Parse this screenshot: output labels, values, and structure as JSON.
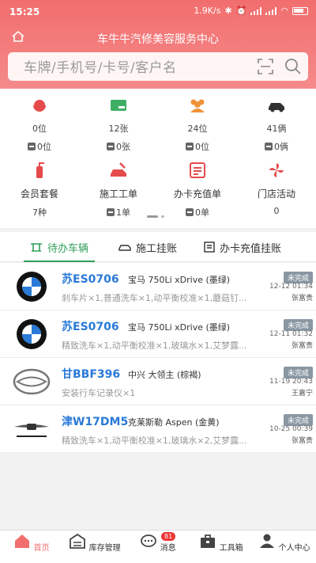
{
  "status_bar": {
    "time": "15:25",
    "speed": "1.9K/s",
    "battery": ""
  },
  "header": {
    "title": "车牛牛汽修美容服务中心"
  },
  "search": {
    "placeholder": "车牌/手机号/卡号/客户名"
  },
  "quick_stats": [
    {
      "icon": "customer-service-icon",
      "value": "0位",
      "sub": "0位"
    },
    {
      "icon": "vip-card-icon",
      "value": "12张",
      "sub": "0张"
    },
    {
      "icon": "members-icon",
      "value": "24位",
      "sub": "0位"
    },
    {
      "icon": "car-icon",
      "value": "41俩",
      "sub": "0俩"
    },
    {
      "icon": "fire-extinguisher-icon",
      "label": "会员套餐",
      "sub": "7种"
    },
    {
      "icon": "car-repair-icon",
      "label": "施工工单",
      "sub": "1单"
    },
    {
      "icon": "card-bill-icon",
      "label": "办卡充值单",
      "sub": "0单"
    },
    {
      "icon": "pinwheel-icon",
      "label": "门店活动",
      "sub": "0"
    }
  ],
  "tabs": [
    {
      "label": "待办车辆",
      "icon": "pending-car-icon"
    },
    {
      "label": "施工挂账",
      "icon": "construction-icon"
    },
    {
      "label": "办卡充值挂账",
      "icon": "card-icon"
    }
  ],
  "vehicles": [
    {
      "logo": "bmw",
      "plate": "苏ES0706",
      "model": "宝马 750Li xDrive (墨绿)",
      "services": "刹车片×1,普通洗车×1,动平衡校准×1,蘑菇钉...",
      "status": "未完成",
      "date": "12-12 01:34",
      "staff": "张富贵"
    },
    {
      "logo": "bmw",
      "plate": "苏ES0706",
      "model": "宝马 750Li xDrive (墨绿)",
      "services": "精致洗车×1,动平衡校准×1,玻璃水×1,艾梦露...",
      "status": "未完成",
      "date": "12-11 01:32",
      "staff": "张富贵"
    },
    {
      "logo": "zhongxing",
      "plate": "甘BBF396",
      "model": "中兴 大领主 (棕褐)",
      "services": "安装行车记录仪×1",
      "status": "未完成",
      "date": "11-19 20:43",
      "staff": "王嘉宁"
    },
    {
      "logo": "chrysler",
      "plate": "津W17DM5",
      "model": "克莱斯勒 Aspen (金黄)",
      "services": "精致洗车×1,动平衡校准×1,玻璃水×2,艾梦露...",
      "status": "未完成",
      "date": "10-25 00:39",
      "staff": "张富贵"
    }
  ],
  "bottom_nav": [
    {
      "label": "首页",
      "icon": "home-icon"
    },
    {
      "label": "库存管理",
      "icon": "warehouse-icon"
    },
    {
      "label": "消息",
      "icon": "message-icon",
      "badge": "81"
    },
    {
      "label": "工具箱",
      "icon": "toolbox-icon"
    },
    {
      "label": "个人中心",
      "icon": "profile-icon"
    }
  ],
  "colors": {
    "brand": "#f26e6e",
    "accent_green": "#2f9e58",
    "plate_blue": "#2a7ad8",
    "status_gray": "#8a97a3"
  }
}
